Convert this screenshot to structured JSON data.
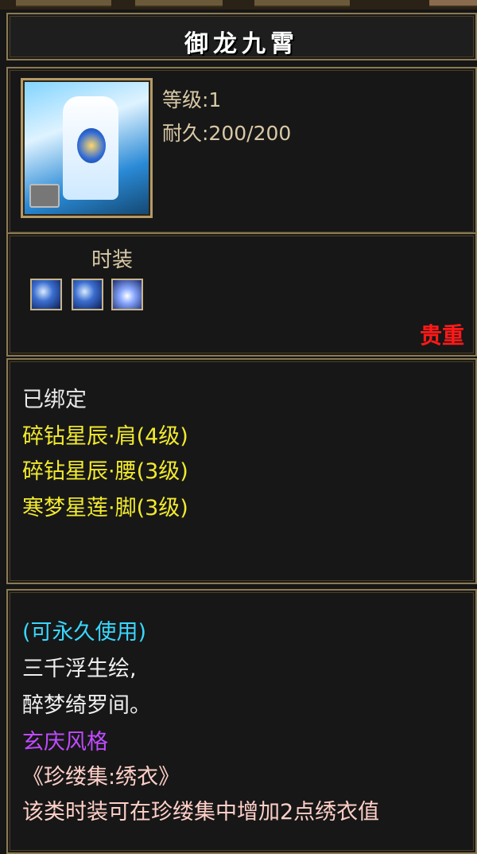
{
  "item": {
    "name": "御龙九霄",
    "level_text": "等级:1",
    "durability_text": "耐久:200/200",
    "category": "时装",
    "rarity": "贵重",
    "bound_text": "已绑定",
    "set_items": [
      "碎钻星辰·肩(4级)",
      "碎钻星辰·腰(3级)",
      "寒梦星莲·脚(3级)"
    ],
    "usage_text": "(可永久使用)",
    "description": [
      "三千浮生绘,",
      "醉梦绮罗间。"
    ],
    "style_text": "玄庆风格",
    "collection_text": "《珍缕集:绣衣》",
    "bonus_text": "该类时装可在珍缕集中增加2点绣衣值"
  },
  "icons": {
    "item_icon": "fashion-outfit-icon",
    "gem_slots": [
      "star-gem-icon",
      "star-gem-icon",
      "star-lotus-gem-icon"
    ]
  },
  "colors": {
    "rarity": "#ff1a1a",
    "set_item": "#f2ea2e",
    "usage": "#39d7ff",
    "style": "#c04aff"
  }
}
